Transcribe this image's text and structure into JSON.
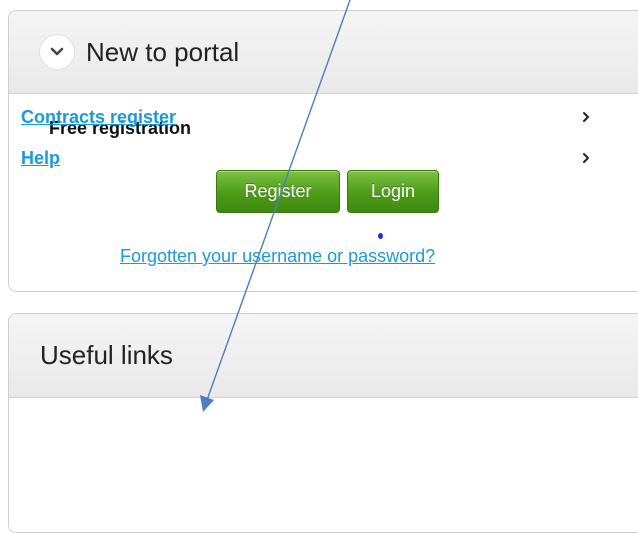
{
  "new_to_portal": {
    "title": "New to portal",
    "subtitle": "Free registration",
    "register_label": "Register",
    "login_label": "Login",
    "forgot_link": "Forgotten your username or password?"
  },
  "useful_links": {
    "title": "Useful links",
    "items": [
      {
        "label": "Contracts register",
        "arrow": "chevron-right-icon"
      },
      {
        "label": "Help",
        "arrow": "chevron-right-icon"
      }
    ]
  },
  "colors": {
    "link": "#1a9bd7",
    "button": "#4d9b1a",
    "annotation_arrow": "#4a7fc1"
  }
}
